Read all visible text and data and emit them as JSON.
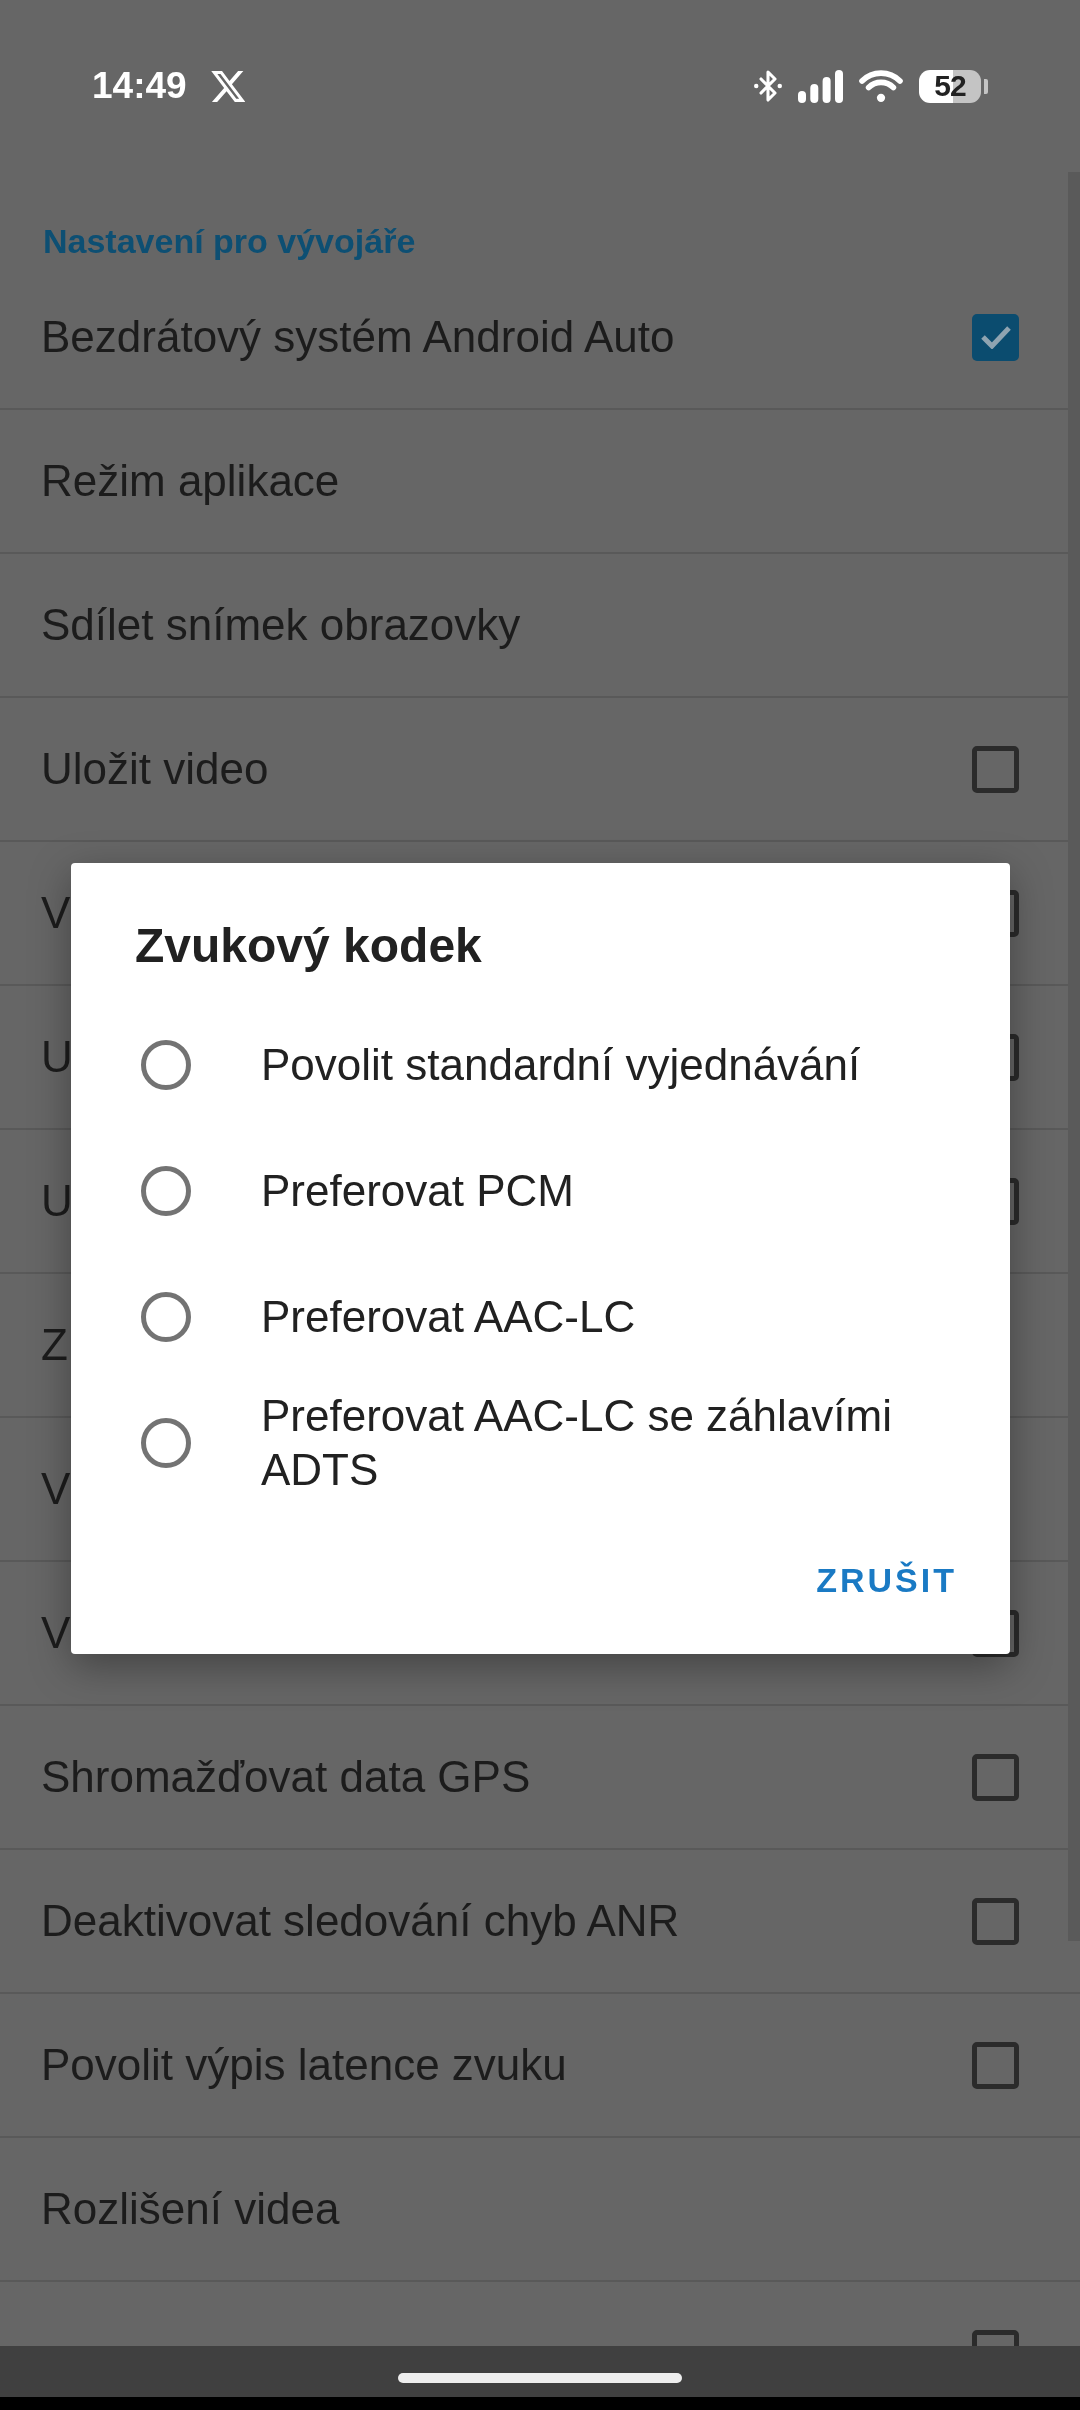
{
  "status_bar": {
    "time": "14:49",
    "battery": "52"
  },
  "settings": {
    "section_header": "Nastavení pro vývojáře",
    "items": [
      {
        "title": "Bezdrátový systém Android Auto",
        "kind": "checkbox",
        "checked": true
      },
      {
        "title": "Režim aplikace",
        "kind": "plain"
      },
      {
        "title": "Sdílet snímek obrazovky",
        "kind": "plain"
      },
      {
        "title": "Uložit video",
        "kind": "checkbox",
        "checked": false
      },
      {
        "title": "V",
        "kind": "checkbox",
        "checked": false
      },
      {
        "title": "U",
        "kind": "checkbox",
        "checked": false
      },
      {
        "title": "U",
        "kind": "checkbox",
        "checked": false
      },
      {
        "title": "Z",
        "kind": "plain"
      },
      {
        "title": "V",
        "kind": "plain"
      },
      {
        "title": "V",
        "kind": "checkbox",
        "checked": false
      },
      {
        "title": "Shromažďovat data GPS",
        "kind": "checkbox",
        "checked": false
      },
      {
        "title": "Deaktivovat sledování chyb ANR",
        "kind": "checkbox",
        "checked": false
      },
      {
        "title": "Povolit výpis latence zvuku",
        "kind": "checkbox",
        "checked": false
      },
      {
        "title": "Rozlišení videa",
        "kind": "plain"
      },
      {
        "kind": "checkbox",
        "checked": false
      }
    ]
  },
  "dialog": {
    "title": "Zvukový kodek",
    "options": [
      {
        "label": "Povolit standardní vyjednávání",
        "selected": false
      },
      {
        "label": "Preferovat PCM",
        "selected": false
      },
      {
        "label": "Preferovat AAC-LC",
        "selected": false
      },
      {
        "label": "Preferovat AAC-LC se záhlavími ADTS",
        "selected": false
      }
    ],
    "cancel_button": {
      "label": "ZRUŠIT"
    }
  }
}
